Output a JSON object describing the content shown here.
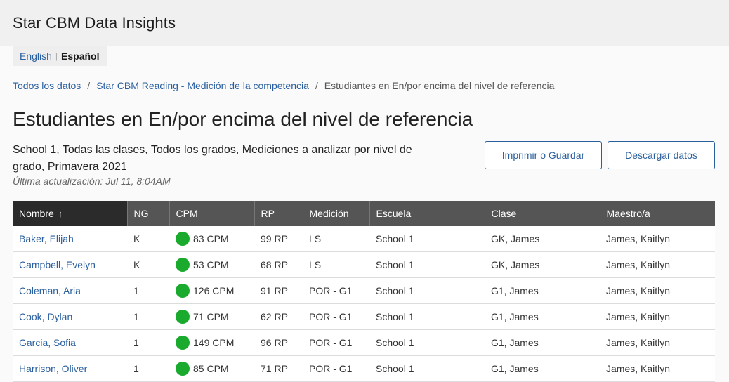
{
  "header": {
    "title": "Star CBM Data Insights"
  },
  "language": {
    "english": "English",
    "spanish": "Español"
  },
  "breadcrumb": [
    "Todos los datos",
    "Star CBM Reading - Medición de la competencia",
    "Estudiantes en En/por encima del nivel de referencia"
  ],
  "page": {
    "title": "Estudiantes en En/por encima del nivel de referencia",
    "subtitle": "School 1, Todas las clases, Todos los grados, Mediciones a analizar por nivel de grado, Primavera 2021",
    "updated": "Última actualización: Jul 11, 8:04AM"
  },
  "actions": {
    "print": "Imprimir o Guardar",
    "download": "Descargar datos"
  },
  "table": {
    "headers": [
      "Nombre",
      "NG",
      "CPM",
      "RP",
      "Medición",
      "Escuela",
      "Clase",
      "Maestro/a"
    ],
    "sort_indicator": "↑",
    "status_color": "#1aab2e",
    "rows": [
      {
        "name": "Baker, Elijah",
        "ng": "K",
        "cpm": "83 CPM",
        "rp": "99 RP",
        "medicion": "LS",
        "escuela": "School 1",
        "clase": "GK, James",
        "maestro": "James, Kaitlyn"
      },
      {
        "name": "Campbell, Evelyn",
        "ng": "K",
        "cpm": "53 CPM",
        "rp": "68 RP",
        "medicion": "LS",
        "escuela": "School 1",
        "clase": "GK, James",
        "maestro": "James, Kaitlyn"
      },
      {
        "name": "Coleman, Aria",
        "ng": "1",
        "cpm": "126 CPM",
        "rp": "91 RP",
        "medicion": "POR - G1",
        "escuela": "School 1",
        "clase": "G1, James",
        "maestro": "James, Kaitlyn"
      },
      {
        "name": "Cook, Dylan",
        "ng": "1",
        "cpm": "71 CPM",
        "rp": "62 RP",
        "medicion": "POR - G1",
        "escuela": "School 1",
        "clase": "G1, James",
        "maestro": "James, Kaitlyn"
      },
      {
        "name": "Garcia, Sofia",
        "ng": "1",
        "cpm": "149 CPM",
        "rp": "96 RP",
        "medicion": "POR - G1",
        "escuela": "School 1",
        "clase": "G1, James",
        "maestro": "James, Kaitlyn"
      },
      {
        "name": "Harrison, Oliver",
        "ng": "1",
        "cpm": "85 CPM",
        "rp": "71 RP",
        "medicion": "POR - G1",
        "escuela": "School 1",
        "clase": "G1, James",
        "maestro": "James, Kaitlyn"
      }
    ]
  }
}
